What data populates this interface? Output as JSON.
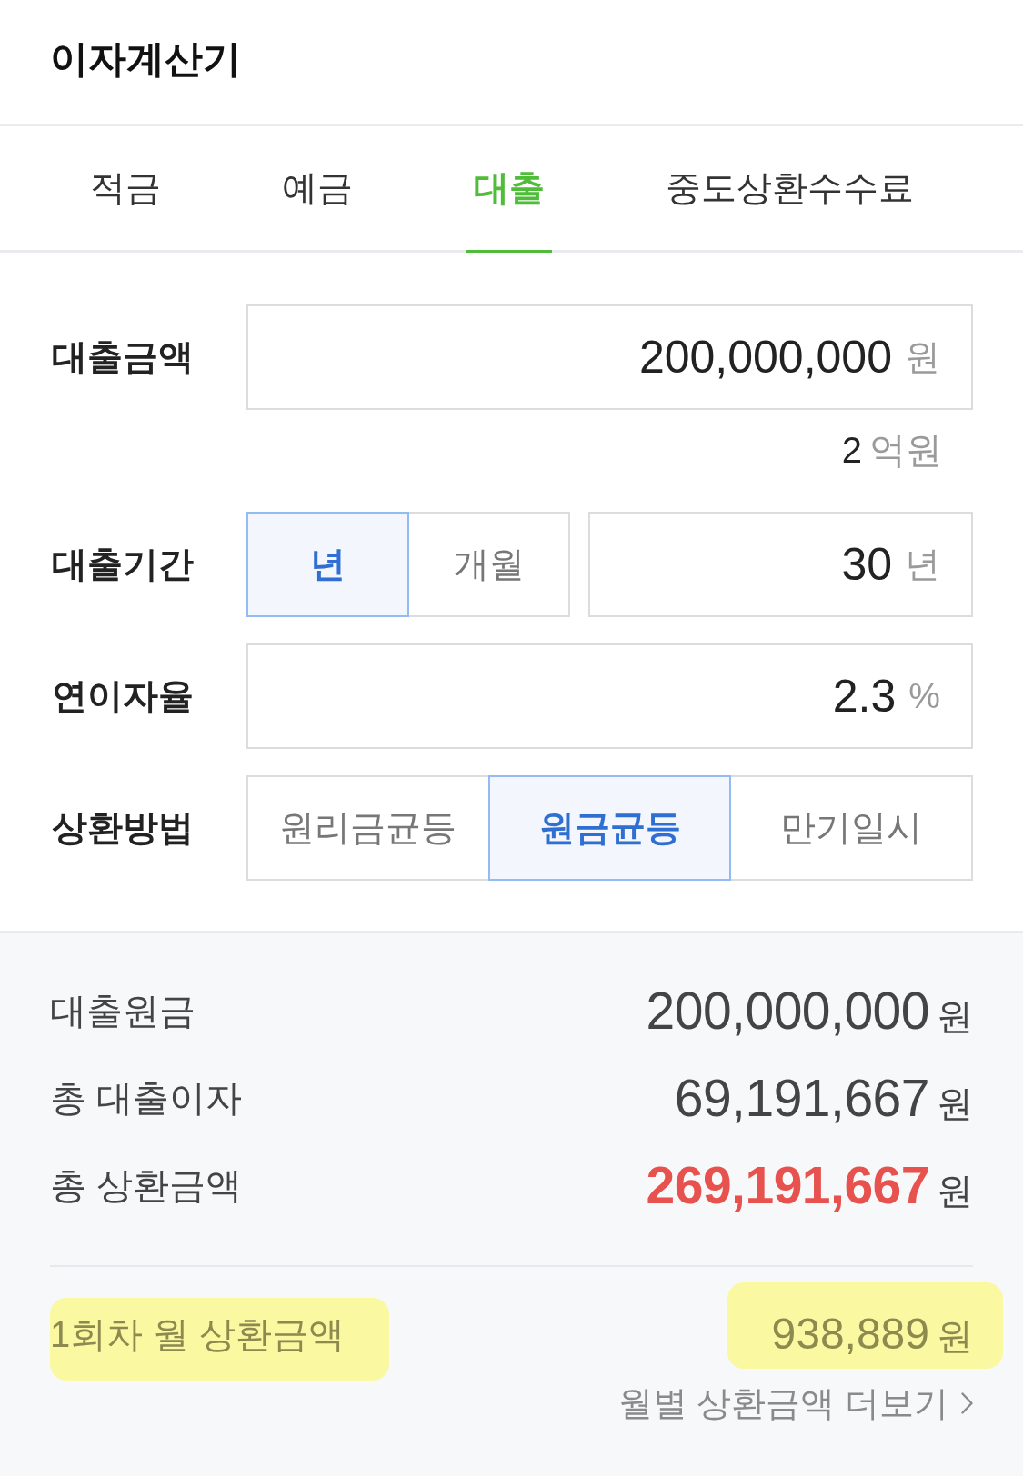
{
  "header": {
    "title": "이자계산기"
  },
  "tabs": [
    {
      "label": "적금",
      "selected": false
    },
    {
      "label": "예금",
      "selected": false
    },
    {
      "label": "대출",
      "selected": true
    },
    {
      "label": "중도상환수수료",
      "selected": false
    }
  ],
  "form": {
    "fields": [
      {
        "kind": "input",
        "label": "대출금액",
        "value": "200,000,000",
        "unit": "원",
        "hint": {
          "value": "2",
          "unit": "억원"
        }
      },
      {
        "kind": "period",
        "label": "대출기간",
        "options": [
          {
            "label": "년",
            "selected": true
          },
          {
            "label": "개월",
            "selected": false
          }
        ],
        "value": "30",
        "unit": "년"
      },
      {
        "kind": "input",
        "label": "연이자율",
        "value": "2.3",
        "unit": "%"
      },
      {
        "kind": "choice",
        "label": "상환방법",
        "options": [
          {
            "label": "원리금균등",
            "selected": false
          },
          {
            "label": "원금균등",
            "selected": true
          },
          {
            "label": "만기일시",
            "selected": false
          }
        ]
      }
    ]
  },
  "summary": {
    "rows": [
      {
        "label": "대출원금",
        "value": "200,000,000",
        "unit": "원",
        "emphasis": false
      },
      {
        "label": "총 대출이자",
        "value": "69,191,667",
        "unit": "원",
        "emphasis": false
      },
      {
        "label": "총 상환금액",
        "value": "269,191,667",
        "unit": "원",
        "emphasis": true
      }
    ]
  },
  "monthly_payment": {
    "label": "1회차 월 상환금액",
    "value": "938,889",
    "unit": "원",
    "highlighted": true
  },
  "more_link": {
    "label": "월별 상환금액 더보기"
  }
}
